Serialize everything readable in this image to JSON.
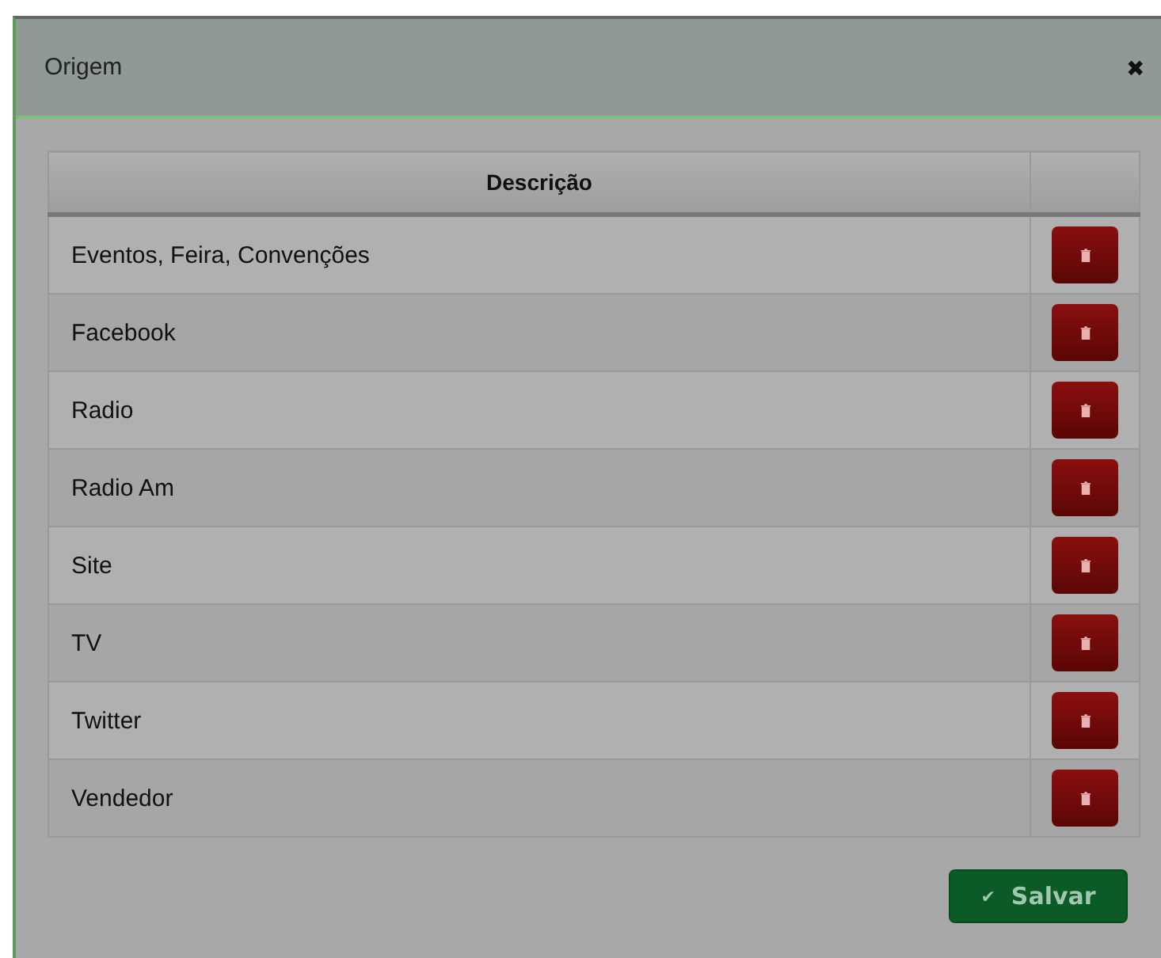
{
  "dialog": {
    "title": "Origem",
    "close": "✖"
  },
  "table": {
    "columns": [
      "Descrição"
    ],
    "rows": [
      "Eventos, Feira, Convenções",
      "Facebook",
      "Radio",
      "Radio Am",
      "Site",
      "TV",
      "Twitter",
      "Vendedor"
    ]
  },
  "buttons": [
    {
      "label": "Salvar",
      "icon": "✔"
    }
  ]
}
